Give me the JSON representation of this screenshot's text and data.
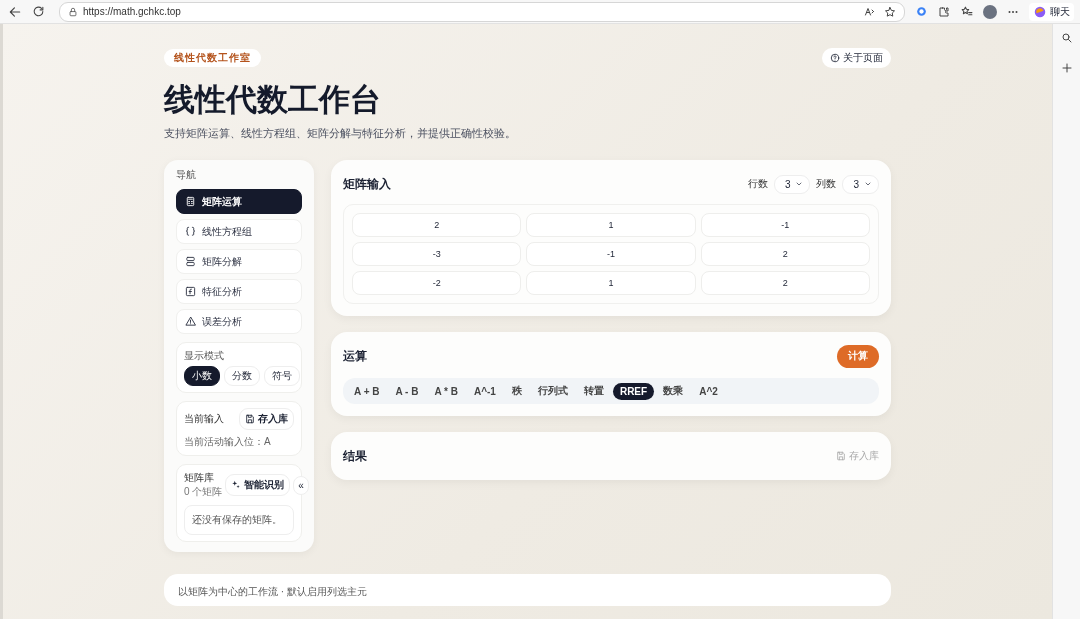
{
  "browser": {
    "url": "https://math.gchkc.top",
    "chat_label": "聊天"
  },
  "header": {
    "badge": "线性代数工作室",
    "about_button": "关于页面",
    "title": "线性代数工作台",
    "subtitle": "支持矩阵运算、线性方程组、矩阵分解与特征分析，并提供正确性校验。"
  },
  "sidebar": {
    "nav_heading": "导航",
    "nav_items": [
      {
        "label": "矩阵运算",
        "selected": true
      },
      {
        "label": "线性方程组",
        "selected": false
      },
      {
        "label": "矩阵分解",
        "selected": false
      },
      {
        "label": "特征分析",
        "selected": false
      },
      {
        "label": "误差分析",
        "selected": false
      }
    ],
    "display_mode": {
      "label": "显示模式",
      "options": [
        {
          "label": "小数",
          "selected": true
        },
        {
          "label": "分数",
          "selected": false
        },
        {
          "label": "符号",
          "selected": false
        }
      ]
    },
    "current_input": {
      "label": "当前输入",
      "save_button": "存入库",
      "status": "当前活动输入位：A"
    },
    "library": {
      "title": "矩阵库",
      "count": "0 个矩阵",
      "recognize_button": "智能识别",
      "collapse_button": "«",
      "empty_text": "还没有保存的矩阵。"
    }
  },
  "matrix_input": {
    "title": "矩阵输入",
    "rows_label": "行数",
    "rows_value": "3",
    "cols_label": "列数",
    "cols_value": "3",
    "cells": [
      [
        "2",
        "1",
        "-1"
      ],
      [
        "-3",
        "-1",
        "2"
      ],
      [
        "-2",
        "1",
        "2"
      ]
    ]
  },
  "operation": {
    "title": "运算",
    "compute_button": "计算",
    "ops": [
      {
        "label": "A + B",
        "selected": false
      },
      {
        "label": "A - B",
        "selected": false
      },
      {
        "label": "A * B",
        "selected": false
      },
      {
        "label": "A^-1",
        "selected": false
      },
      {
        "label": "秩",
        "selected": false
      },
      {
        "label": "行列式",
        "selected": false
      },
      {
        "label": "转置",
        "selected": false
      },
      {
        "label": "RREF",
        "selected": true
      },
      {
        "label": "数乘",
        "selected": false
      },
      {
        "label": "A^2",
        "selected": false
      }
    ]
  },
  "result": {
    "title": "结果",
    "save_button": {
      "label": "存入库",
      "disabled": true
    }
  },
  "footer": {
    "text": "以矩阵为中心的工作流 · 默认启用列选主元"
  }
}
